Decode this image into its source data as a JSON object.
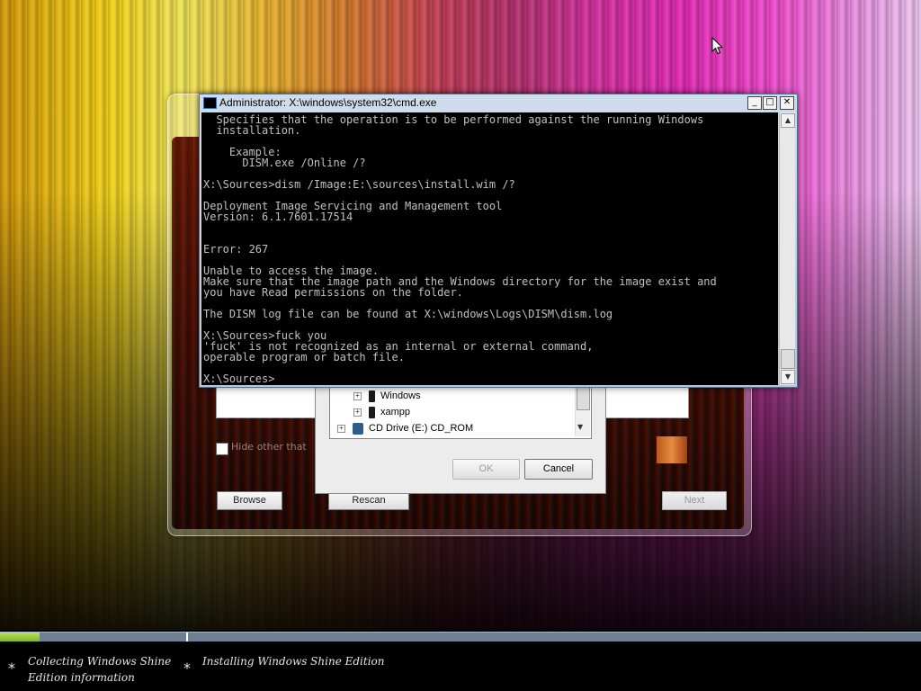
{
  "cmd": {
    "title": "Administrator: X:\\windows\\system32\\cmd.exe",
    "buttons": {
      "minimize": "_",
      "maximize": "□",
      "close": "✕"
    },
    "console_lines": [
      "  Specifies that the operation is to be performed against the running Windows",
      "  installation.",
      "",
      "    Example:",
      "      DISM.exe /Online /?",
      "",
      "X:\\Sources>dism /Image:E:\\sources\\install.wim /?",
      "",
      "Deployment Image Servicing and Management tool",
      "Version: 6.1.7601.17514",
      "",
      "",
      "Error: 267",
      "",
      "Unable to access the image.",
      "Make sure that the image path and the Windows directory for the image exist and",
      "you have Read permissions on the folder.",
      "",
      "The DISM log file can be found at X:\\windows\\Logs\\DISM\\dism.log",
      "",
      "X:\\Sources>fuck you",
      "'fuck' is not recognized as an internal or external command,",
      "operable program or batch file.",
      "",
      "X:\\Sources>"
    ]
  },
  "folder_dialog": {
    "tree": [
      {
        "label": "Windows",
        "expander": "+"
      },
      {
        "label": "xampp",
        "expander": "+"
      },
      {
        "label": "CD Drive (E:) CD_ROM",
        "expander": "+"
      }
    ],
    "ok_label": "OK",
    "cancel_label": "Cancel"
  },
  "setup": {
    "checkbox_label": "Hide other that",
    "browse_label": "Browse",
    "rescan_label": "Rescan",
    "next_label": "Next"
  },
  "progress": {
    "fraction": 0.043
  },
  "steps": [
    {
      "label": "Collecting Windows Shine Edition information"
    },
    {
      "label": "Installing Windows Shine Edition"
    }
  ],
  "step_bullet": "*",
  "colors": {
    "console_bg": "#000000",
    "console_fg": "#c0c0c0",
    "progress_fill": "#8cc63f",
    "progress_track": "#6e7f93"
  }
}
